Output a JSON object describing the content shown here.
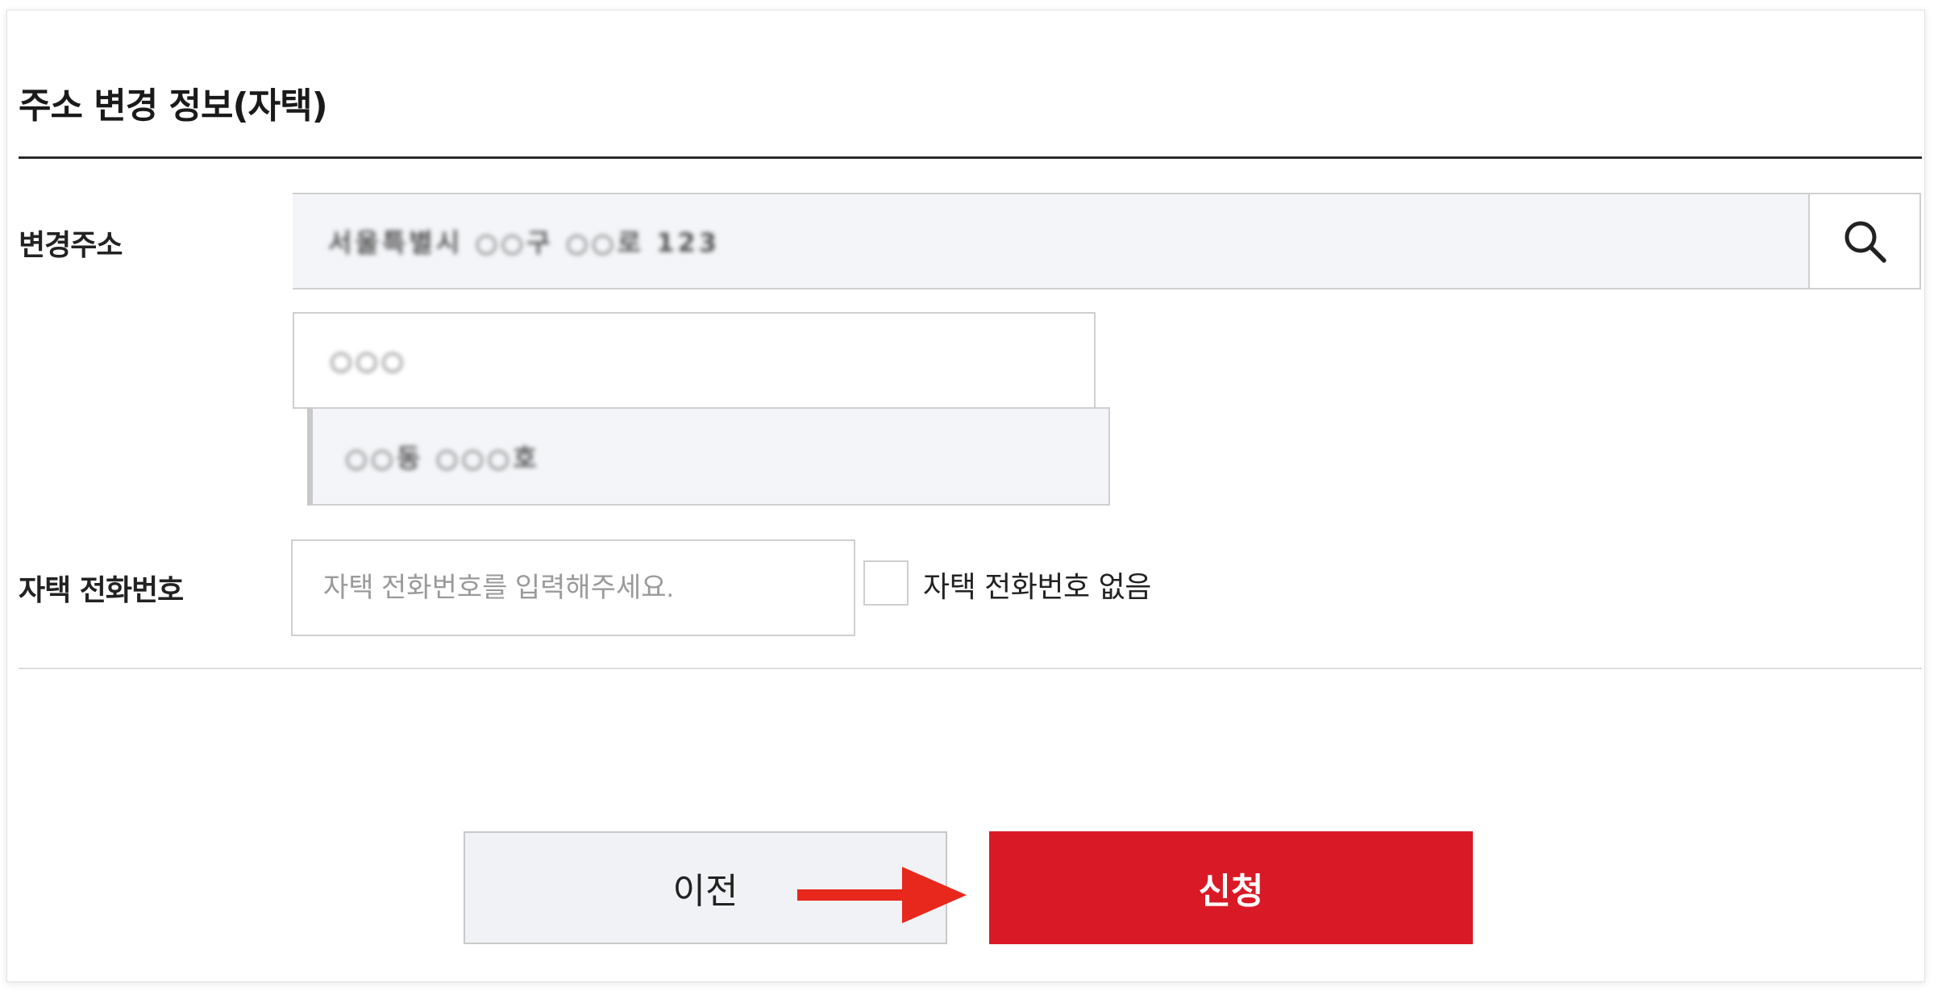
{
  "section": {
    "title": "주소 변경 정보(자택)"
  },
  "address": {
    "label": "변경주소",
    "main_value": "서울특별시 ○○구 ○○로 123",
    "postcode": "○○○",
    "detail_value": "○○동 ○○○호",
    "search_icon": "search-icon"
  },
  "phone": {
    "label": "자택 전화번호",
    "placeholder": "자택 전화번호를 입력해주세요.",
    "no_phone_label": "자택 전화번호 없음"
  },
  "buttons": {
    "prev_label": "이전",
    "submit_label": "신청"
  },
  "colors": {
    "accent": "#d91a26",
    "annotation_arrow": "#e8281c",
    "field_fill": "#f4f5f8"
  }
}
